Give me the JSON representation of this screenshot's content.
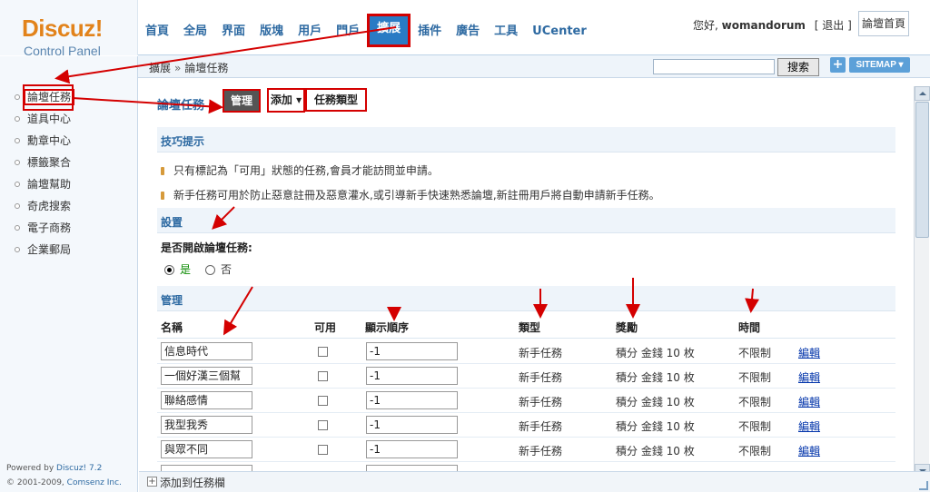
{
  "header": {
    "logo_main": "Discuz!",
    "logo_sub": "Control Panel",
    "nav": [
      "首頁",
      "全局",
      "界面",
      "版塊",
      "用戶",
      "門戶",
      "擴展",
      "插件",
      "廣告",
      "工具",
      "UCenter"
    ],
    "active_nav": "擴展",
    "greeting_prefix": "您好,",
    "username": "womandorum",
    "logout": "[ 退出 ]",
    "home_button": "論壇首頁"
  },
  "subbar": {
    "crumb_parent": "擴展",
    "crumb_sep": "»",
    "crumb_current": "論壇任務",
    "search_button": "搜索",
    "plus_button": "+",
    "sitemap_button": "SITEMAP ▾"
  },
  "sidebar": {
    "items": [
      "論壇任務",
      "道具中心",
      "勳章中心",
      "標籤聚合",
      "論壇幫助",
      "奇虎搜索",
      "電子商務",
      "企業郵局"
    ],
    "active_index": 0,
    "footer_powered": "Powered by",
    "footer_brand": "Discuz! 7.2",
    "footer_copy": "© 2001-2009,",
    "footer_company": "Comsenz Inc."
  },
  "main": {
    "page_title": "論壇任務",
    "tab_manage": "管理",
    "tab_add": "添加 ▾",
    "tab_types": "任務類型",
    "tips_title": "技巧提示",
    "tips": [
      "只有標記為「可用」狀態的任務,會員才能訪問並申請。",
      "新手任務可用於防止惡意註冊及惡意灌水,或引導新手快速熟悉論壇,新註冊用戶將自動申請新手任務。"
    ],
    "settings_title": "設置",
    "setting_label": "是否開啟論壇任務:",
    "radio_yes": "是",
    "radio_no": "否",
    "radio_selected": "是",
    "manage_title": "管理",
    "columns": {
      "name": "名稱",
      "enabled": "可用",
      "order": "顯示順序",
      "type": "類型",
      "reward": "獎勵",
      "time": "時間"
    },
    "rows": [
      {
        "name": "信息時代",
        "enabled": false,
        "order": "-1",
        "type": "新手任務",
        "reward": "積分 金錢 10 枚",
        "time": "不限制",
        "action": "編輯"
      },
      {
        "name": "一個好漢三個幫",
        "enabled": false,
        "order": "-1",
        "type": "新手任務",
        "reward": "積分 金錢 10 枚",
        "time": "不限制",
        "action": "編輯"
      },
      {
        "name": "聯絡感情",
        "enabled": false,
        "order": "-1",
        "type": "新手任務",
        "reward": "積分 金錢 10 枚",
        "time": "不限制",
        "action": "編輯"
      },
      {
        "name": "我型我秀",
        "enabled": false,
        "order": "-1",
        "type": "新手任務",
        "reward": "積分 金錢 10 枚",
        "time": "不限制",
        "action": "編輯"
      },
      {
        "name": "與眾不同",
        "enabled": false,
        "order": "-1",
        "type": "新手任務",
        "reward": "積分 金錢 10 枚",
        "time": "不限制",
        "action": "編輯"
      }
    ]
  },
  "bottombar": {
    "add_box": "+",
    "add_label": "添加到任務欄"
  },
  "colors": {
    "accent": "#2e6aa2",
    "logo_orange": "#e2831b",
    "annotation_red": "#d40000"
  }
}
